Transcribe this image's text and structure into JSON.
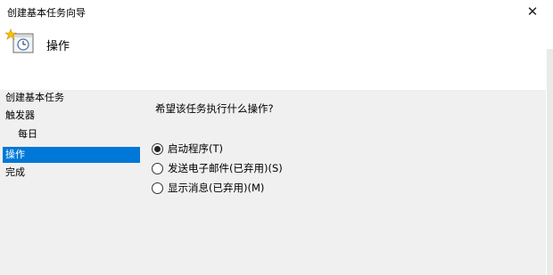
{
  "window": {
    "title": "创建基本任务向导",
    "close_glyph": "✕"
  },
  "header": {
    "title": "操作",
    "icon": "task-clock-icon"
  },
  "nav": {
    "items": [
      {
        "label": "创建基本任务",
        "selected": false,
        "indent": false
      },
      {
        "label": "触发器",
        "selected": false,
        "indent": false
      },
      {
        "label": "每日",
        "selected": false,
        "indent": true
      },
      {
        "label": "操作",
        "selected": true,
        "indent": false
      },
      {
        "label": "完成",
        "selected": false,
        "indent": false
      }
    ]
  },
  "main": {
    "question": "希望该任务执行什么操作?",
    "options": [
      {
        "label": "启动程序(T)",
        "checked": true
      },
      {
        "label": "发送电子邮件(已弃用)(S)",
        "checked": false
      },
      {
        "label": "显示消息(已弃用)(M)",
        "checked": false
      }
    ]
  },
  "colors": {
    "selection": "#0078d7",
    "body_bg": "#f0f0f0"
  }
}
